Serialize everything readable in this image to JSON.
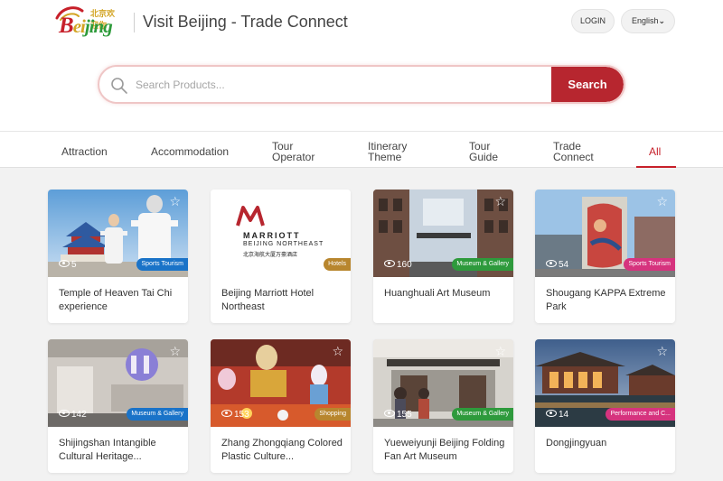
{
  "header": {
    "logo_cn": "北京欢迎你",
    "logo_en_1": "B",
    "logo_en_2": "ei",
    "logo_en_3": "jing",
    "title": "Visit Beijing - Trade Connect",
    "login_label": "LOGIN",
    "language_label": "English"
  },
  "search": {
    "placeholder": "Search Products...",
    "button_label": "Search"
  },
  "tabs": [
    {
      "label": "Attraction"
    },
    {
      "label": "Accommodation"
    },
    {
      "label": "Tour Operator"
    },
    {
      "label": "Itinerary Theme"
    },
    {
      "label": "Tour Guide"
    },
    {
      "label": "Trade Connect"
    },
    {
      "label": "All"
    }
  ],
  "cards": [
    {
      "title": "Temple of Heaven Tai Chi experience",
      "badge": "Sports Tourism",
      "views": "5"
    },
    {
      "title": "Beijing Marriott Hotel Northeast",
      "badge": "Hotels",
      "views": "",
      "brand": "MARRIOTT",
      "brand_sub": "BEIJING NORTHEAST",
      "brand_cn": "北京海航大厦万豪酒店"
    },
    {
      "title": "Huanghuali Art Museum",
      "badge": "Museum & Gallery",
      "views": "160"
    },
    {
      "title": "Shougang KAPPA Extreme Park",
      "badge": "Sports Tourism",
      "views": "54"
    },
    {
      "title": "Shijingshan Intangible Cultural Heritage...",
      "badge": "Museum & Gallery",
      "views": "142"
    },
    {
      "title": "Zhang Zhongqiang Colored Plastic Culture...",
      "badge": "Shopping",
      "views": "153"
    },
    {
      "title": "Yueweiyunji Beijing Folding Fan Art Museum",
      "badge": "Museum & Gallery",
      "views": "155"
    },
    {
      "title": "Dongjingyuan",
      "badge": "Performance and C...",
      "views": "14"
    }
  ],
  "colors": {
    "brand_red": "#b7262f",
    "badge_blue": "#1a73c8",
    "badge_brown": "#b8862e",
    "badge_green": "#2e9a3c",
    "badge_magenta": "#d6337e"
  }
}
